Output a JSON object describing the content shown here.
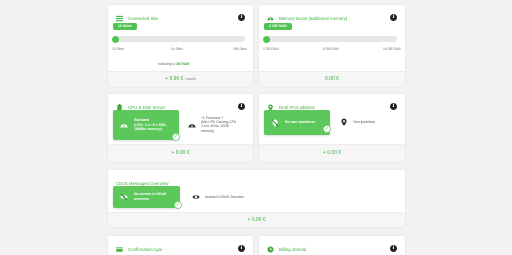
{
  "connections": {
    "title": "Connected Site",
    "badge": "10 Sites",
    "ticks": [
      "10 Sites",
      "64 Sites",
      "956 Sites"
    ],
    "note_prefix": "Including",
    "note_value": "1 GB RAM",
    "price": "+ 9.90 €",
    "price_unit": "/ month",
    "level": 0
  },
  "memory": {
    "title": "Memory Boost (additional memory)",
    "badge": "0 GB RAM",
    "ticks": [
      "0 GB RAM",
      "8 GB RAM",
      "16 GB RAM"
    ],
    "price": "0.00 €",
    "level": 0
  },
  "cpu": {
    "title": "CPU & Disk Server",
    "selected_lines": [
      "Standard",
      "(CPU: 2.4 / 2 x SSD,",
      "16MB/s memory)"
    ],
    "alt_lines": [
      "+1 Processor +",
      "(Min CPU Caching CPU",
      "2.4 to 4GHz, 32GB",
      "memory)"
    ],
    "price": "+ 0.00 €"
  },
  "ip": {
    "title": "Dedi IPv4 address",
    "selected_label": "No own ipaddress",
    "alt_label": "Own ipaddress",
    "price": "+ 0.00 €"
  },
  "overview": {
    "title": "CDoS Messages Overview",
    "selected_lines": [
      "No access to DDoS",
      "overview"
    ],
    "alt_label": "Access to DDoS Overview",
    "price": "+ 0.00 €"
  },
  "billing": {
    "title": "Confirmation type"
  },
  "interval": {
    "title": "Billing interval"
  },
  "icons": {
    "connections": "lines-icon",
    "memory": "gauge-icon",
    "cpu": "battery-icon",
    "ip": "pin-icon",
    "info": "info-icon",
    "billing": "card-icon",
    "interval": "clock-icon"
  },
  "colors": {
    "accent": "#4fc34f",
    "text_accent": "#3fae3f",
    "background": "#f2f2f2"
  }
}
